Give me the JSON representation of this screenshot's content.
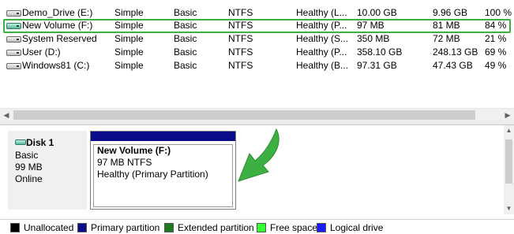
{
  "volumes": [
    {
      "name": "Demo_Drive (E:)",
      "layout": "Simple",
      "type": "Basic",
      "fs": "NTFS",
      "status": "Healthy (L...",
      "capacity": "10.00 GB",
      "free": "9.96 GB",
      "pct": "100 %",
      "icon": "drive-icon"
    },
    {
      "name": "New Volume (F:)",
      "layout": "Simple",
      "type": "Basic",
      "fs": "NTFS",
      "status": "Healthy (P...",
      "capacity": "97 MB",
      "free": "81 MB",
      "pct": "84 %",
      "icon": "drive-icon-green"
    },
    {
      "name": "System Reserved",
      "layout": "Simple",
      "type": "Basic",
      "fs": "NTFS",
      "status": "Healthy (S...",
      "capacity": "350 MB",
      "free": "72 MB",
      "pct": "21 %",
      "icon": "drive-icon"
    },
    {
      "name": "User (D:)",
      "layout": "Simple",
      "type": "Basic",
      "fs": "NTFS",
      "status": "Healthy (P...",
      "capacity": "358.10 GB",
      "free": "248.13 GB",
      "pct": "69 %",
      "icon": "drive-icon"
    },
    {
      "name": "Windows81 (C:)",
      "layout": "Simple",
      "type": "Basic",
      "fs": "NTFS",
      "status": "Healthy (B...",
      "capacity": "97.31 GB",
      "free": "47.43 GB",
      "pct": "49 %",
      "icon": "drive-icon"
    }
  ],
  "selected_volume_index": 1,
  "disk": {
    "name": "Disk 1",
    "type": "Basic",
    "size": "99 MB",
    "state": "Online"
  },
  "partition": {
    "title": "New Volume  (F:)",
    "size_fs": "97 MB NTFS",
    "status": "Healthy (Primary Partition)",
    "header_color": "#0b0c8a"
  },
  "annotation": {
    "icon": "green-curved-arrow-icon",
    "color": "#3cb043"
  },
  "legend": [
    {
      "label": "Unallocated",
      "color": "#000000"
    },
    {
      "label": "Primary partition",
      "color": "#0b0c8a"
    },
    {
      "label": "Extended partition",
      "color": "#1f7a1f"
    },
    {
      "label": "Free space",
      "color": "#33ff33"
    },
    {
      "label": "Logical drive",
      "color": "#1a1aff"
    }
  ]
}
